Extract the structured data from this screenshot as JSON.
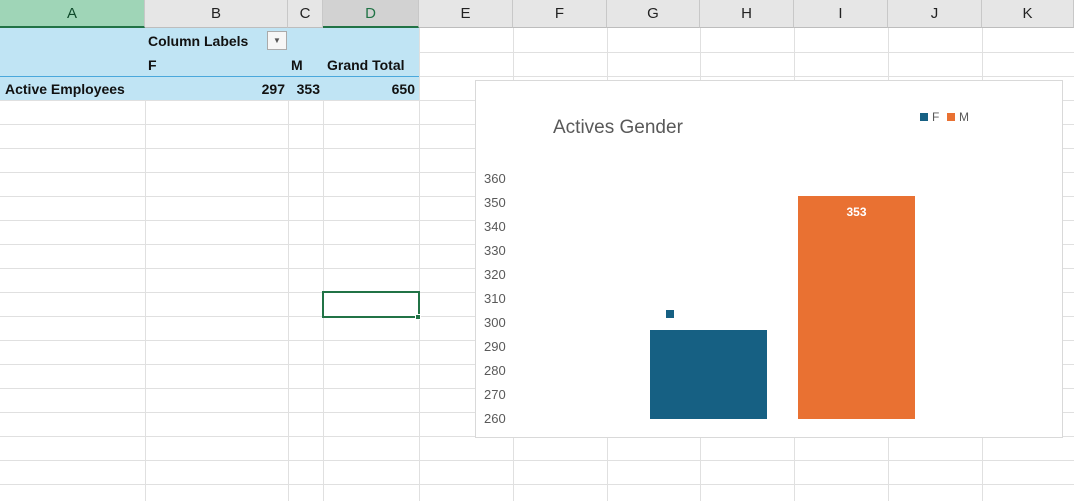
{
  "columns": [
    "A",
    "B",
    "C",
    "D",
    "E",
    "F",
    "G",
    "H",
    "I",
    "J",
    "K"
  ],
  "pivot": {
    "column_labels": "Column Labels",
    "headers": [
      "F",
      "M",
      "Grand Total"
    ],
    "row_label": "Active Employees",
    "values": [
      "297",
      "353",
      "650"
    ]
  },
  "chart_data": {
    "type": "bar",
    "title": "Actives Gender",
    "categories": [
      "F",
      "M"
    ],
    "series": [
      {
        "name": "F",
        "values": [
          297
        ],
        "color": "#166083"
      },
      {
        "name": "M",
        "values": [
          353
        ],
        "color": "#e97132"
      }
    ],
    "ylim": [
      260,
      360
    ],
    "yticks": [
      "360",
      "350",
      "340",
      "330",
      "320",
      "310",
      "300",
      "290",
      "280",
      "270",
      "260"
    ],
    "legend": "top-right",
    "data_labels": {
      "M": "353"
    }
  }
}
